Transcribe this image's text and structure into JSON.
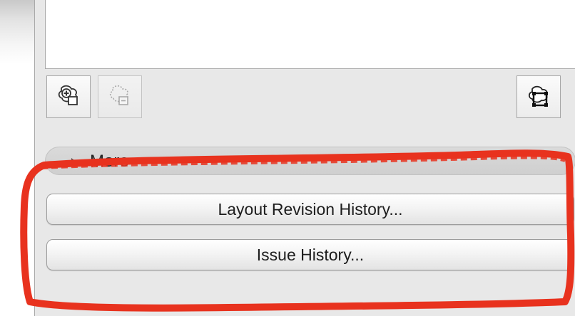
{
  "panel": {
    "more_label": "More",
    "buttons": {
      "layout_revision_history": "Layout Revision History...",
      "issue_history": "Issue History..."
    },
    "toolbar": {
      "add_icon": "add-shape-icon",
      "remove_icon": "remove-shape-icon",
      "edit_icon": "edit-shape-icon"
    }
  },
  "colors": {
    "highlight": "#e8321e",
    "panel_bg": "#e8e8e8"
  }
}
